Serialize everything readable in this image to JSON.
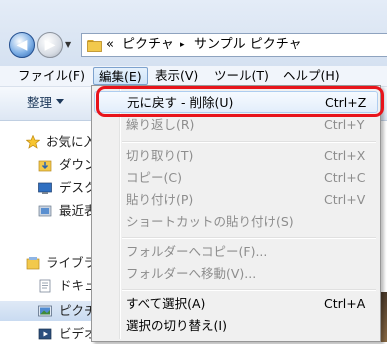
{
  "breadcrumb": {
    "chevrons": "«",
    "separator": "▸",
    "items": [
      "ピクチャ",
      "サンプル ピクチャ"
    ]
  },
  "nav_buttons": {
    "back_glyph": "◀",
    "forward_glyph": "▶",
    "recent_glyph": "▼"
  },
  "menubar": {
    "items": [
      "ファイル(F)",
      "編集(E)",
      "表示(V)",
      "ツール(T)",
      "ヘルプ(H)"
    ],
    "active_index": 1
  },
  "toolbar": {
    "organize_label": "整理"
  },
  "navpane": {
    "items": [
      {
        "label": "お気に入",
        "icon": "star-icon"
      },
      {
        "label": "ダウン",
        "icon": "downloads-folder-icon"
      },
      {
        "label": "デスク",
        "icon": "desktop-icon"
      },
      {
        "label": "最近表",
        "icon": "recent-places-icon"
      },
      {
        "label": "ライブラ",
        "icon": "libraries-icon"
      },
      {
        "label": "ドキュ",
        "icon": "documents-icon"
      },
      {
        "label": "ピクチ",
        "icon": "pictures-icon"
      },
      {
        "label": "ビデオ",
        "icon": "videos-icon"
      }
    ],
    "selected_index": 6
  },
  "edit_menu": {
    "items": [
      {
        "label": "元に戻す - 削除(U)",
        "shortcut": "Ctrl+Z",
        "enabled": true,
        "highlighted": true
      },
      {
        "label": "繰り返し(R)",
        "shortcut": "Ctrl+Y",
        "enabled": false
      },
      {
        "label": "切り取り(T)",
        "shortcut": "Ctrl+X",
        "enabled": false
      },
      {
        "label": "コピー(C)",
        "shortcut": "Ctrl+C",
        "enabled": false
      },
      {
        "label": "貼り付け(P)",
        "shortcut": "Ctrl+V",
        "enabled": false
      },
      {
        "label": "ショートカットの貼り付け(S)",
        "shortcut": "",
        "enabled": false
      },
      {
        "label": "フォルダーへコピー(F)...",
        "shortcut": "",
        "enabled": false
      },
      {
        "label": "フォルダーへ移動(V)...",
        "shortcut": "",
        "enabled": false
      },
      {
        "label": "すべて選択(A)",
        "shortcut": "Ctrl+A",
        "enabled": true
      },
      {
        "label": "選択の切り替え(I)",
        "shortcut": "",
        "enabled": true
      }
    ]
  },
  "colors": {
    "callout": "#e8141b",
    "accent": "#2a64b0"
  }
}
